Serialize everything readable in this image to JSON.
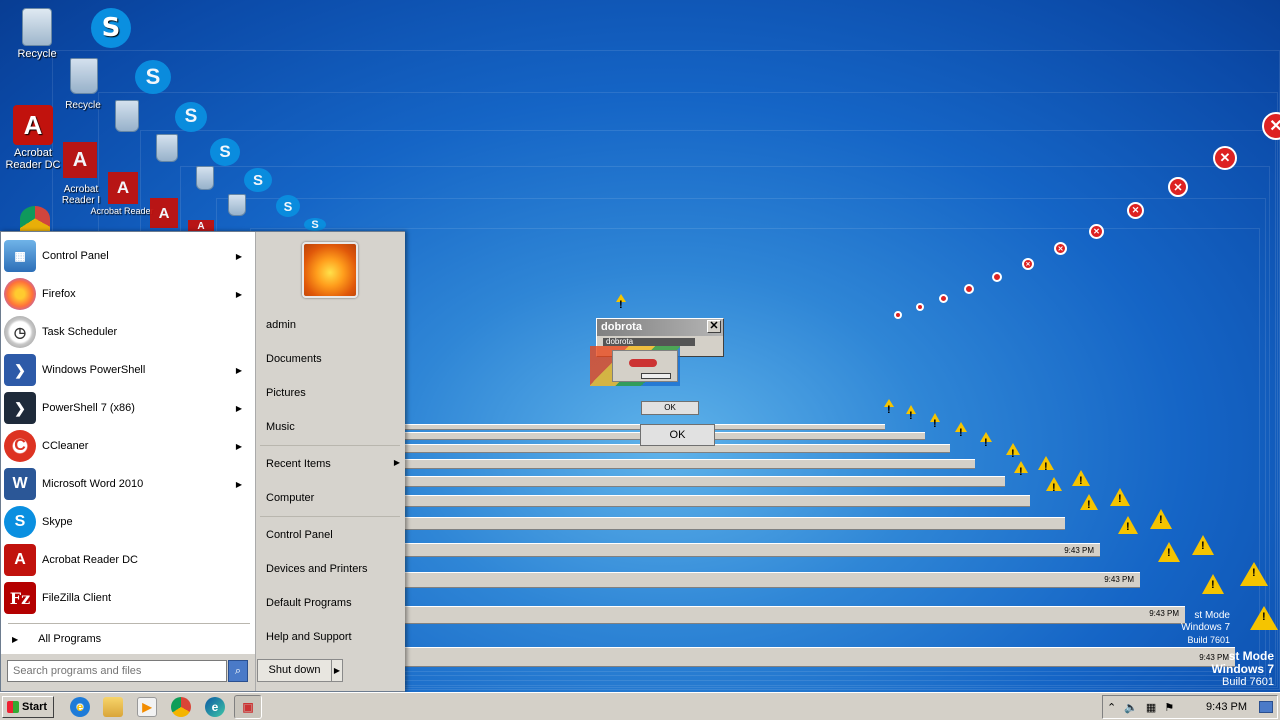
{
  "desktop": {
    "icons": [
      {
        "name": "recycle",
        "label": "Recycle"
      },
      {
        "name": "skype",
        "label": ""
      },
      {
        "name": "acrobat",
        "label": "Acrobat Reader DC"
      }
    ],
    "echo_labels": {
      "recycle_1": "Recycle",
      "acrobat_1": "Acrobat Reader I",
      "acrobat_2": "Acrobat Reader",
      "recycle_2": "Recycle"
    },
    "watermark_main": {
      "line1": "st Mode",
      "line2": "Windows 7",
      "line3": "Build 7601"
    },
    "watermark_echo": {
      "line1": "st Mode",
      "line2": "Windows 7",
      "line3": "Build 7601"
    }
  },
  "dialog": {
    "title": "dobrota",
    "close_glyph": "✕",
    "ok_label": "OK",
    "echo_title": "dobrota",
    "echo_ok": "OK"
  },
  "start_menu": {
    "left_items": [
      {
        "label": "Control Panel",
        "icon": "control-panel-icon",
        "has_submenu": true
      },
      {
        "label": "Firefox",
        "icon": "firefox-icon",
        "has_submenu": true
      },
      {
        "label": "Task Scheduler",
        "icon": "clock-icon",
        "has_submenu": false
      },
      {
        "label": "Windows PowerShell",
        "icon": "powershell-icon",
        "has_submenu": true
      },
      {
        "label": "PowerShell 7 (x86)",
        "icon": "powershell7-icon",
        "has_submenu": true
      },
      {
        "label": "CCleaner",
        "icon": "ccleaner-icon",
        "has_submenu": true
      },
      {
        "label": "Microsoft Word 2010",
        "icon": "word-icon",
        "has_submenu": true
      },
      {
        "label": "Skype",
        "icon": "skype-icon",
        "has_submenu": false
      },
      {
        "label": "Acrobat Reader DC",
        "icon": "acrobat-icon",
        "has_submenu": false
      },
      {
        "label": "FileZilla Client",
        "icon": "filezilla-icon",
        "has_submenu": false
      }
    ],
    "all_programs": "All Programs",
    "search_placeholder": "Search programs and files",
    "right_items": [
      {
        "label": "admin"
      },
      {
        "label": "Documents"
      },
      {
        "label": "Pictures"
      },
      {
        "label": "Music"
      },
      {
        "label": "Recent Items"
      },
      {
        "label": "Computer"
      },
      {
        "label": "Control Panel"
      },
      {
        "label": "Devices and Printers"
      },
      {
        "label": "Default Programs"
      },
      {
        "label": "Help and Support"
      }
    ],
    "shutdown_label": "Shut down"
  },
  "taskbar": {
    "start_label": "Start",
    "pinned": [
      "ie-icon",
      "explorer-icon",
      "media-player-icon",
      "chrome-icon",
      "edge-icon",
      "app-window-icon"
    ],
    "clock": "9:43 PM",
    "echo_clock": "9:43 PM"
  },
  "colors": {
    "desktop_bg": "#1565c6",
    "taskbar": "#d4d0c8",
    "start_menu_right": "#d6d3cd",
    "error_red": "#dd2222",
    "warning_yellow": "#f5c400"
  }
}
